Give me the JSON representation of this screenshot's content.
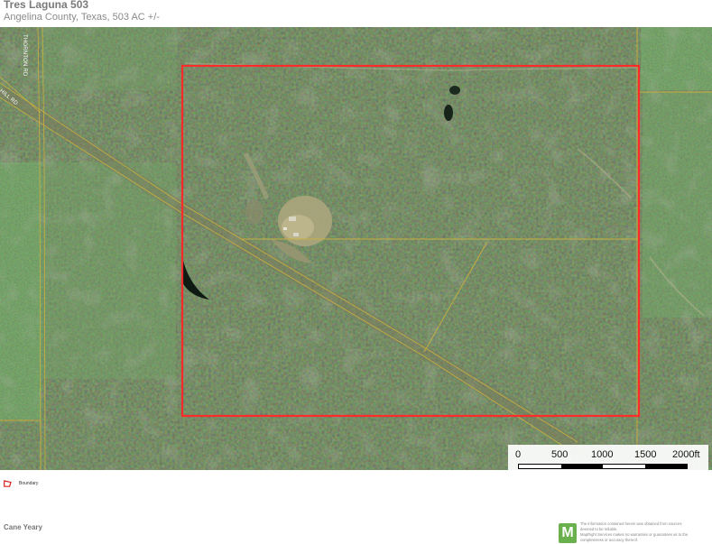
{
  "header": {
    "title": "Tres Laguna 503",
    "subtitle": "Angelina County, Texas, 503 AC +/-"
  },
  "map": {
    "imagery": "satellite-aerial-forest",
    "boundary_color": "#ff2a2a",
    "parcel_line_color": "#c9b040",
    "road_labels": [
      {
        "text": "THORNTON RD"
      },
      {
        "text": "HILL RD"
      }
    ]
  },
  "scale": {
    "labels": [
      "0",
      "500",
      "1000",
      "1500",
      "2000ft"
    ]
  },
  "legend": {
    "items": [
      {
        "label": "Boundary",
        "color": "#d62020",
        "icon": "boundary-swatch-icon"
      }
    ]
  },
  "footer": {
    "agent_name": "Cane Yeary",
    "logo_letter": "M",
    "logo_color": "#6ab04c",
    "disclaimer": [
      "The information contained herein was obtained from sources",
      "deemed to be reliable.",
      "MapRight Services makes no warranties or guarantees as to the",
      "completeness or accuracy thereof."
    ]
  }
}
